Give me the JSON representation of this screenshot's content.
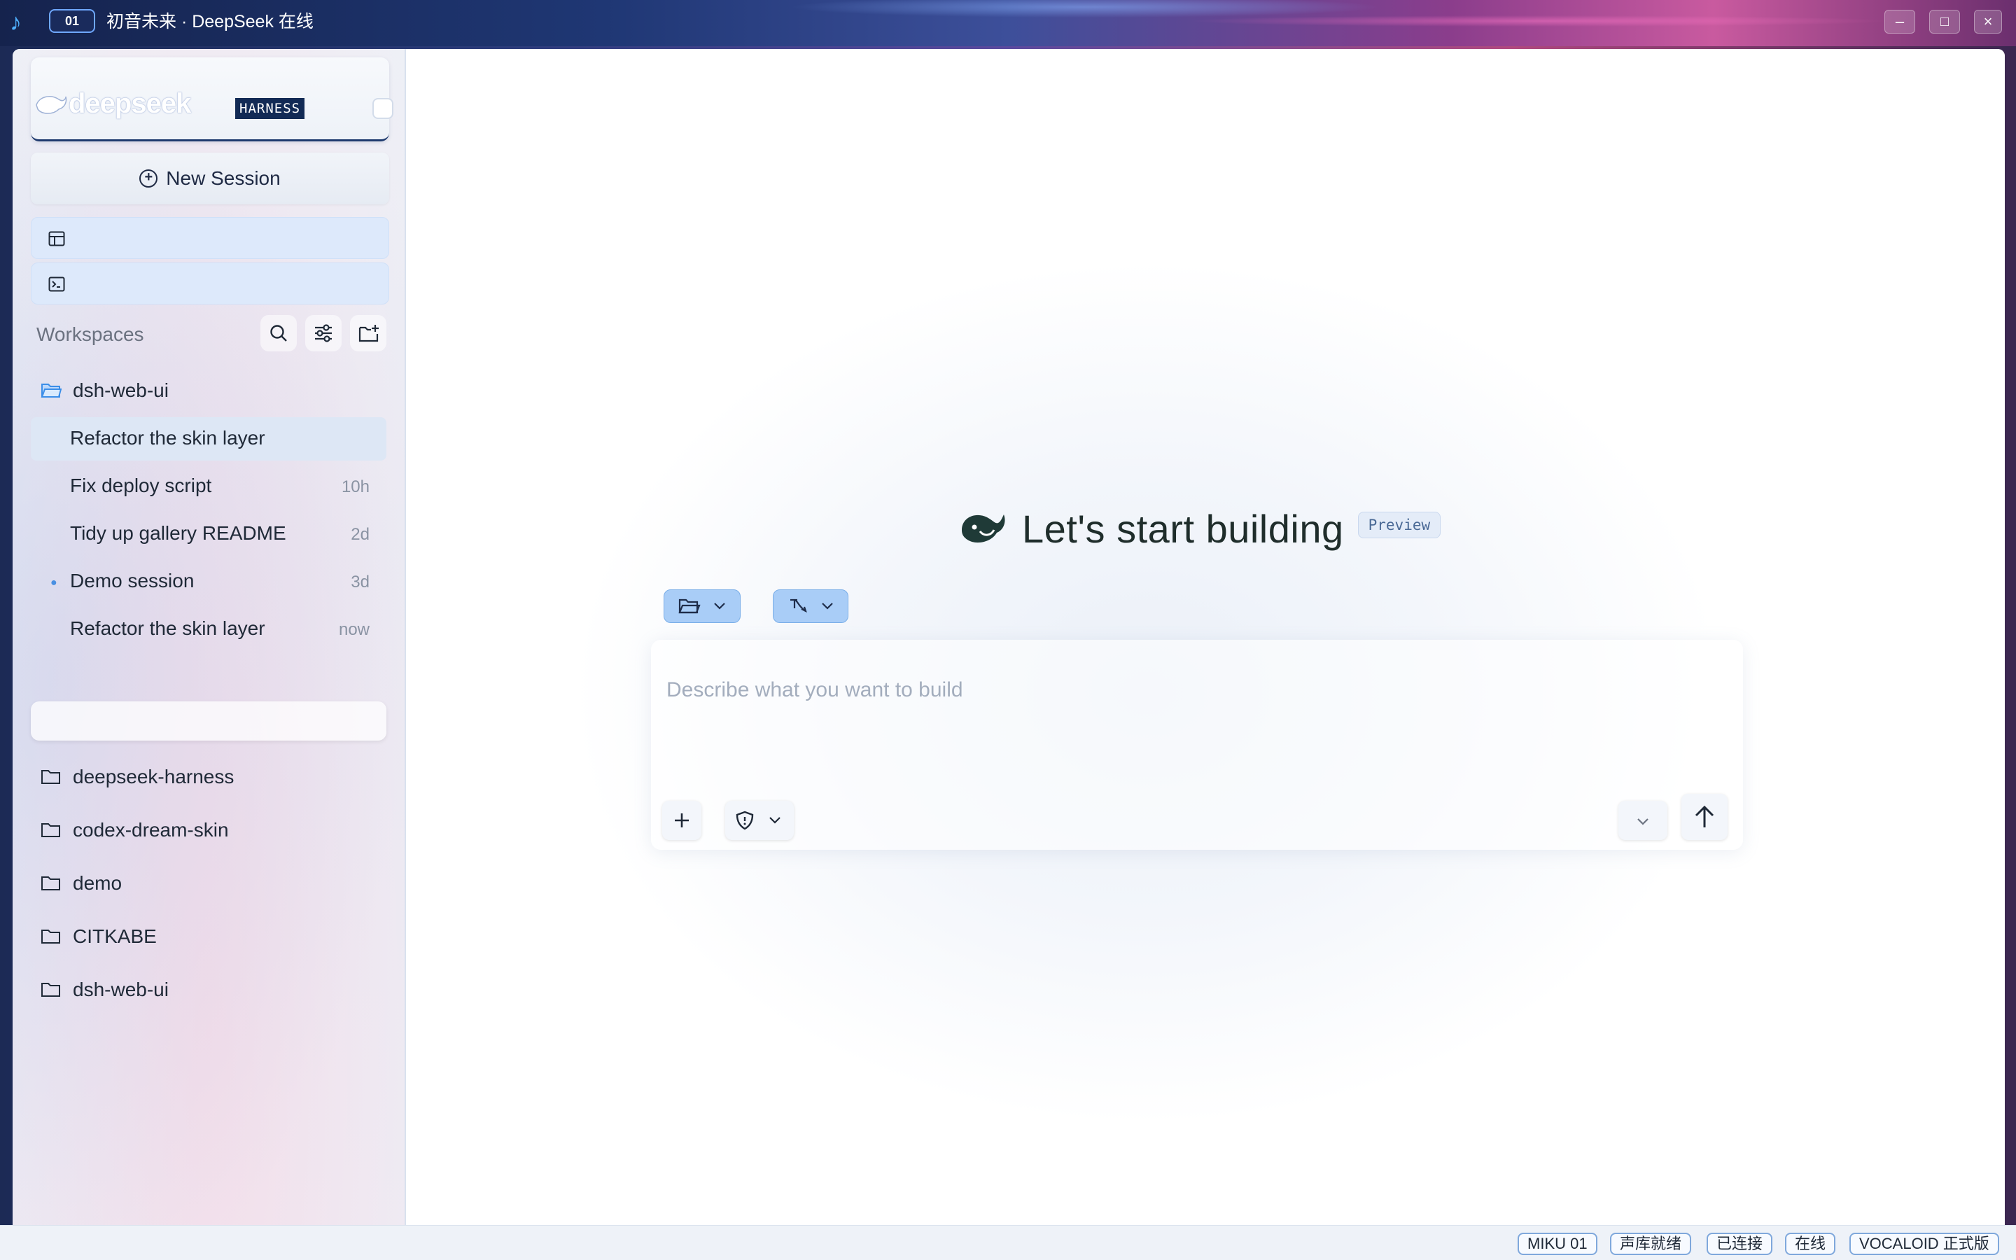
{
  "window": {
    "badge": "01",
    "title": "初音未来 · DeepSeek 在线",
    "minimize": "–",
    "maximize": "□",
    "close": "×"
  },
  "sidebar": {
    "logo_text": "deepseek",
    "logo_badge": "HARNESS",
    "new_session_label": "New Session",
    "workspaces_label": "Workspaces",
    "active_workspace": {
      "name": "dsh-web-ui",
      "sessions": [
        {
          "title": "Refactor the skin layer",
          "time": ""
        },
        {
          "title": "Fix deploy script",
          "time": "10h"
        },
        {
          "title": "Tidy up gallery README",
          "time": "2d"
        },
        {
          "title": "Demo session",
          "time": "3d"
        },
        {
          "title": "Refactor the skin layer",
          "time": "now"
        }
      ]
    },
    "workspaces": [
      {
        "name": "deepseek-harness"
      },
      {
        "name": "codex-dream-skin"
      },
      {
        "name": "demo"
      },
      {
        "name": "CITKABE"
      },
      {
        "name": "dsh-web-ui"
      }
    ]
  },
  "main": {
    "title": "Let's start building",
    "preview_badge": "Preview",
    "prompt_placeholder": "Describe what you want to build"
  },
  "statusbar": {
    "chips": [
      "MIKU 01",
      "声库就绪",
      "已连接",
      "在线",
      "VOCALOID 正式版"
    ]
  },
  "colors": {
    "accent": "#a9cdf7",
    "nav_active": "#dde9fb",
    "logo_badge_bg": "#122a55",
    "status_chip_border": "#7fa8dc"
  }
}
